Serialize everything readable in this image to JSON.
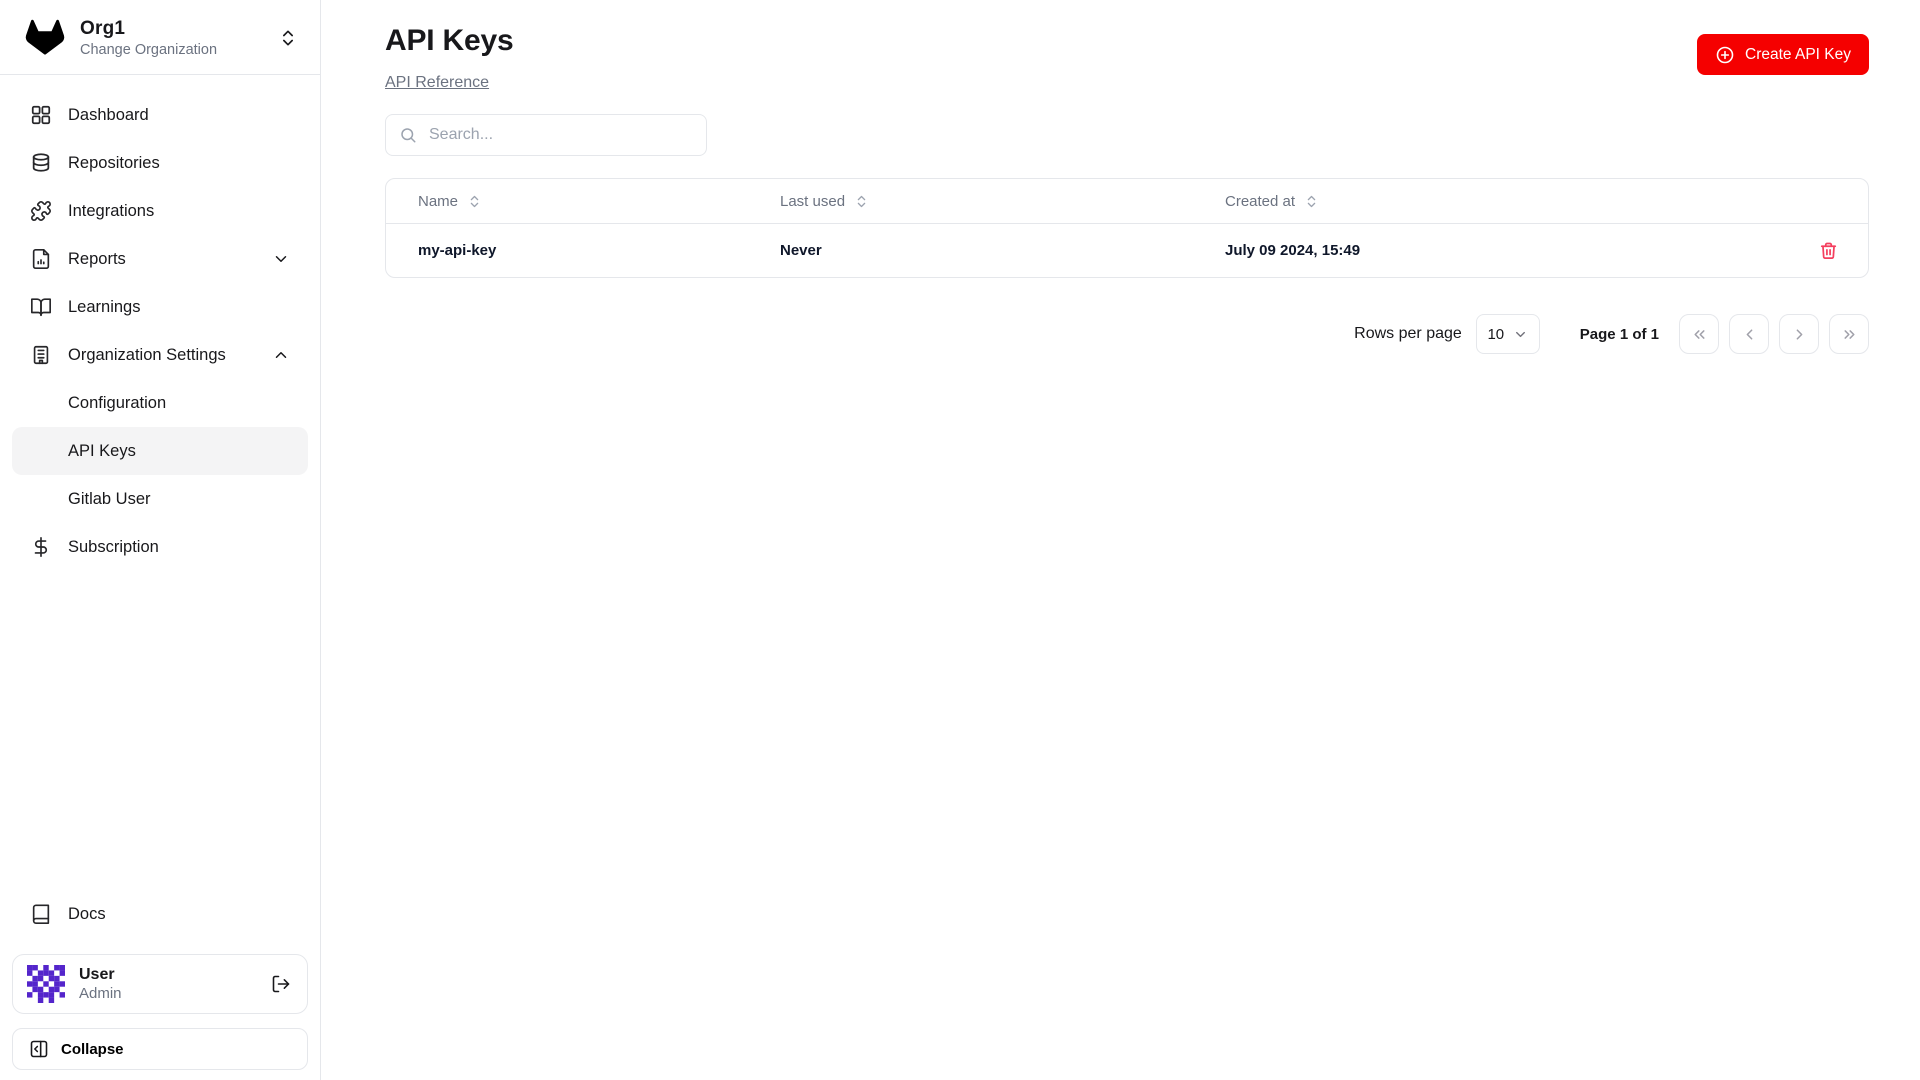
{
  "org": {
    "name": "Org1",
    "subtitle": "Change Organization"
  },
  "nav": {
    "items": [
      {
        "label": "Dashboard"
      },
      {
        "label": "Repositories"
      },
      {
        "label": "Integrations"
      },
      {
        "label": "Reports"
      },
      {
        "label": "Learnings"
      },
      {
        "label": "Organization Settings"
      }
    ],
    "org_settings_children": [
      {
        "label": "Configuration"
      },
      {
        "label": "API Keys"
      },
      {
        "label": "Gitlab User"
      }
    ],
    "subscription_label": "Subscription",
    "docs_label": "Docs"
  },
  "user": {
    "name": "User",
    "role": "Admin"
  },
  "collapse_label": "Collapse",
  "page": {
    "title": "API Keys",
    "reference_link": "API Reference",
    "search_placeholder": "Search...",
    "create_button": "Create API Key"
  },
  "table": {
    "columns": [
      "Name",
      "Last used",
      "Created at"
    ],
    "rows": [
      {
        "name": "my-api-key",
        "last_used": "Never",
        "created_at": "July 09 2024, 15:49"
      }
    ]
  },
  "pagination": {
    "rows_per_page_label": "Rows per page",
    "page_size": "10",
    "page_info": "Page 1 of 1"
  },
  "colors": {
    "accent": "#f50000",
    "danger": "#f43f5e",
    "avatar": "#5425cb"
  }
}
